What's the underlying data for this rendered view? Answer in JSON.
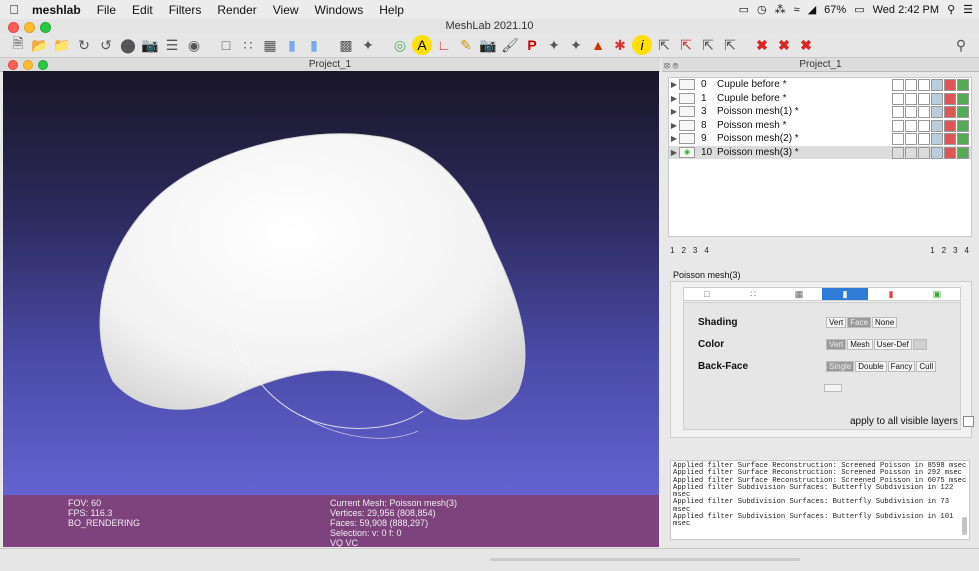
{
  "menubar": {
    "app": "meshlab",
    "items": [
      "File",
      "Edit",
      "Filters",
      "Render",
      "View",
      "Windows",
      "Help"
    ],
    "battery": "67%",
    "clock": "Wed 2:42 PM"
  },
  "window_title": "MeshLab 2021.10",
  "project_title": "Project_1",
  "right_panel_title": "Project_1",
  "layers": [
    {
      "num": "0",
      "name": "Cupule before *"
    },
    {
      "num": "1",
      "name": "Cupule before *"
    },
    {
      "num": "3",
      "name": "Poisson mesh(1) *"
    },
    {
      "num": "8",
      "name": "Poisson mesh *"
    },
    {
      "num": "9",
      "name": "Poisson mesh(2) *"
    },
    {
      "num": "10",
      "name": "Poisson mesh(3) *"
    }
  ],
  "pages_left": [
    "1",
    "2",
    "3",
    "4"
  ],
  "pages_right": [
    "1",
    "2",
    "3",
    "4"
  ],
  "render_panel": {
    "title": "Poisson mesh(3)",
    "shading_label": "Shading",
    "shading_options": [
      "Vert",
      "Face",
      "None"
    ],
    "color_label": "Color",
    "color_options": [
      "Vert",
      "Mesh",
      "User-Def"
    ],
    "backface_label": "Back-Face",
    "backface_options": [
      "Single",
      "Double",
      "Fancy",
      "Cull"
    ],
    "apply_label": "apply to all visible layers"
  },
  "viewport_info": {
    "fov": "FOV: 60",
    "fps": "FPS:   116.3",
    "mode": "BO_RENDERING",
    "current": "Current Mesh: Poisson mesh(3)",
    "vertices": "Vertices: 29,956    (808,854)",
    "faces": "Faces: 59,908     (888,297)",
    "selection": "Selection: v: 0 f: 0",
    "vqvc": "VQ VC"
  },
  "log_lines": [
    "Applied filter Surface Reconstruction: Screened Poisson in 8598 msec",
    "Applied filter Surface Reconstruction: Screened Poisson in 292 msec",
    "Applied filter Surface Reconstruction: Screened Poisson in 6075 msec",
    "Applied filter Subdivision Surfaces: Butterfly Subdivision in 122",
    "msec",
    "Applied filter Subdivision Surfaces: Butterfly Subdivision in 73 msec",
    "Applied filter Subdivision Surfaces: Butterfly Subdivision in 101",
    "msec"
  ],
  "colors": {
    "accent": "#2f7bd8",
    "viewport_bottom": "#6e6ce0",
    "info_bar": "#804078"
  }
}
